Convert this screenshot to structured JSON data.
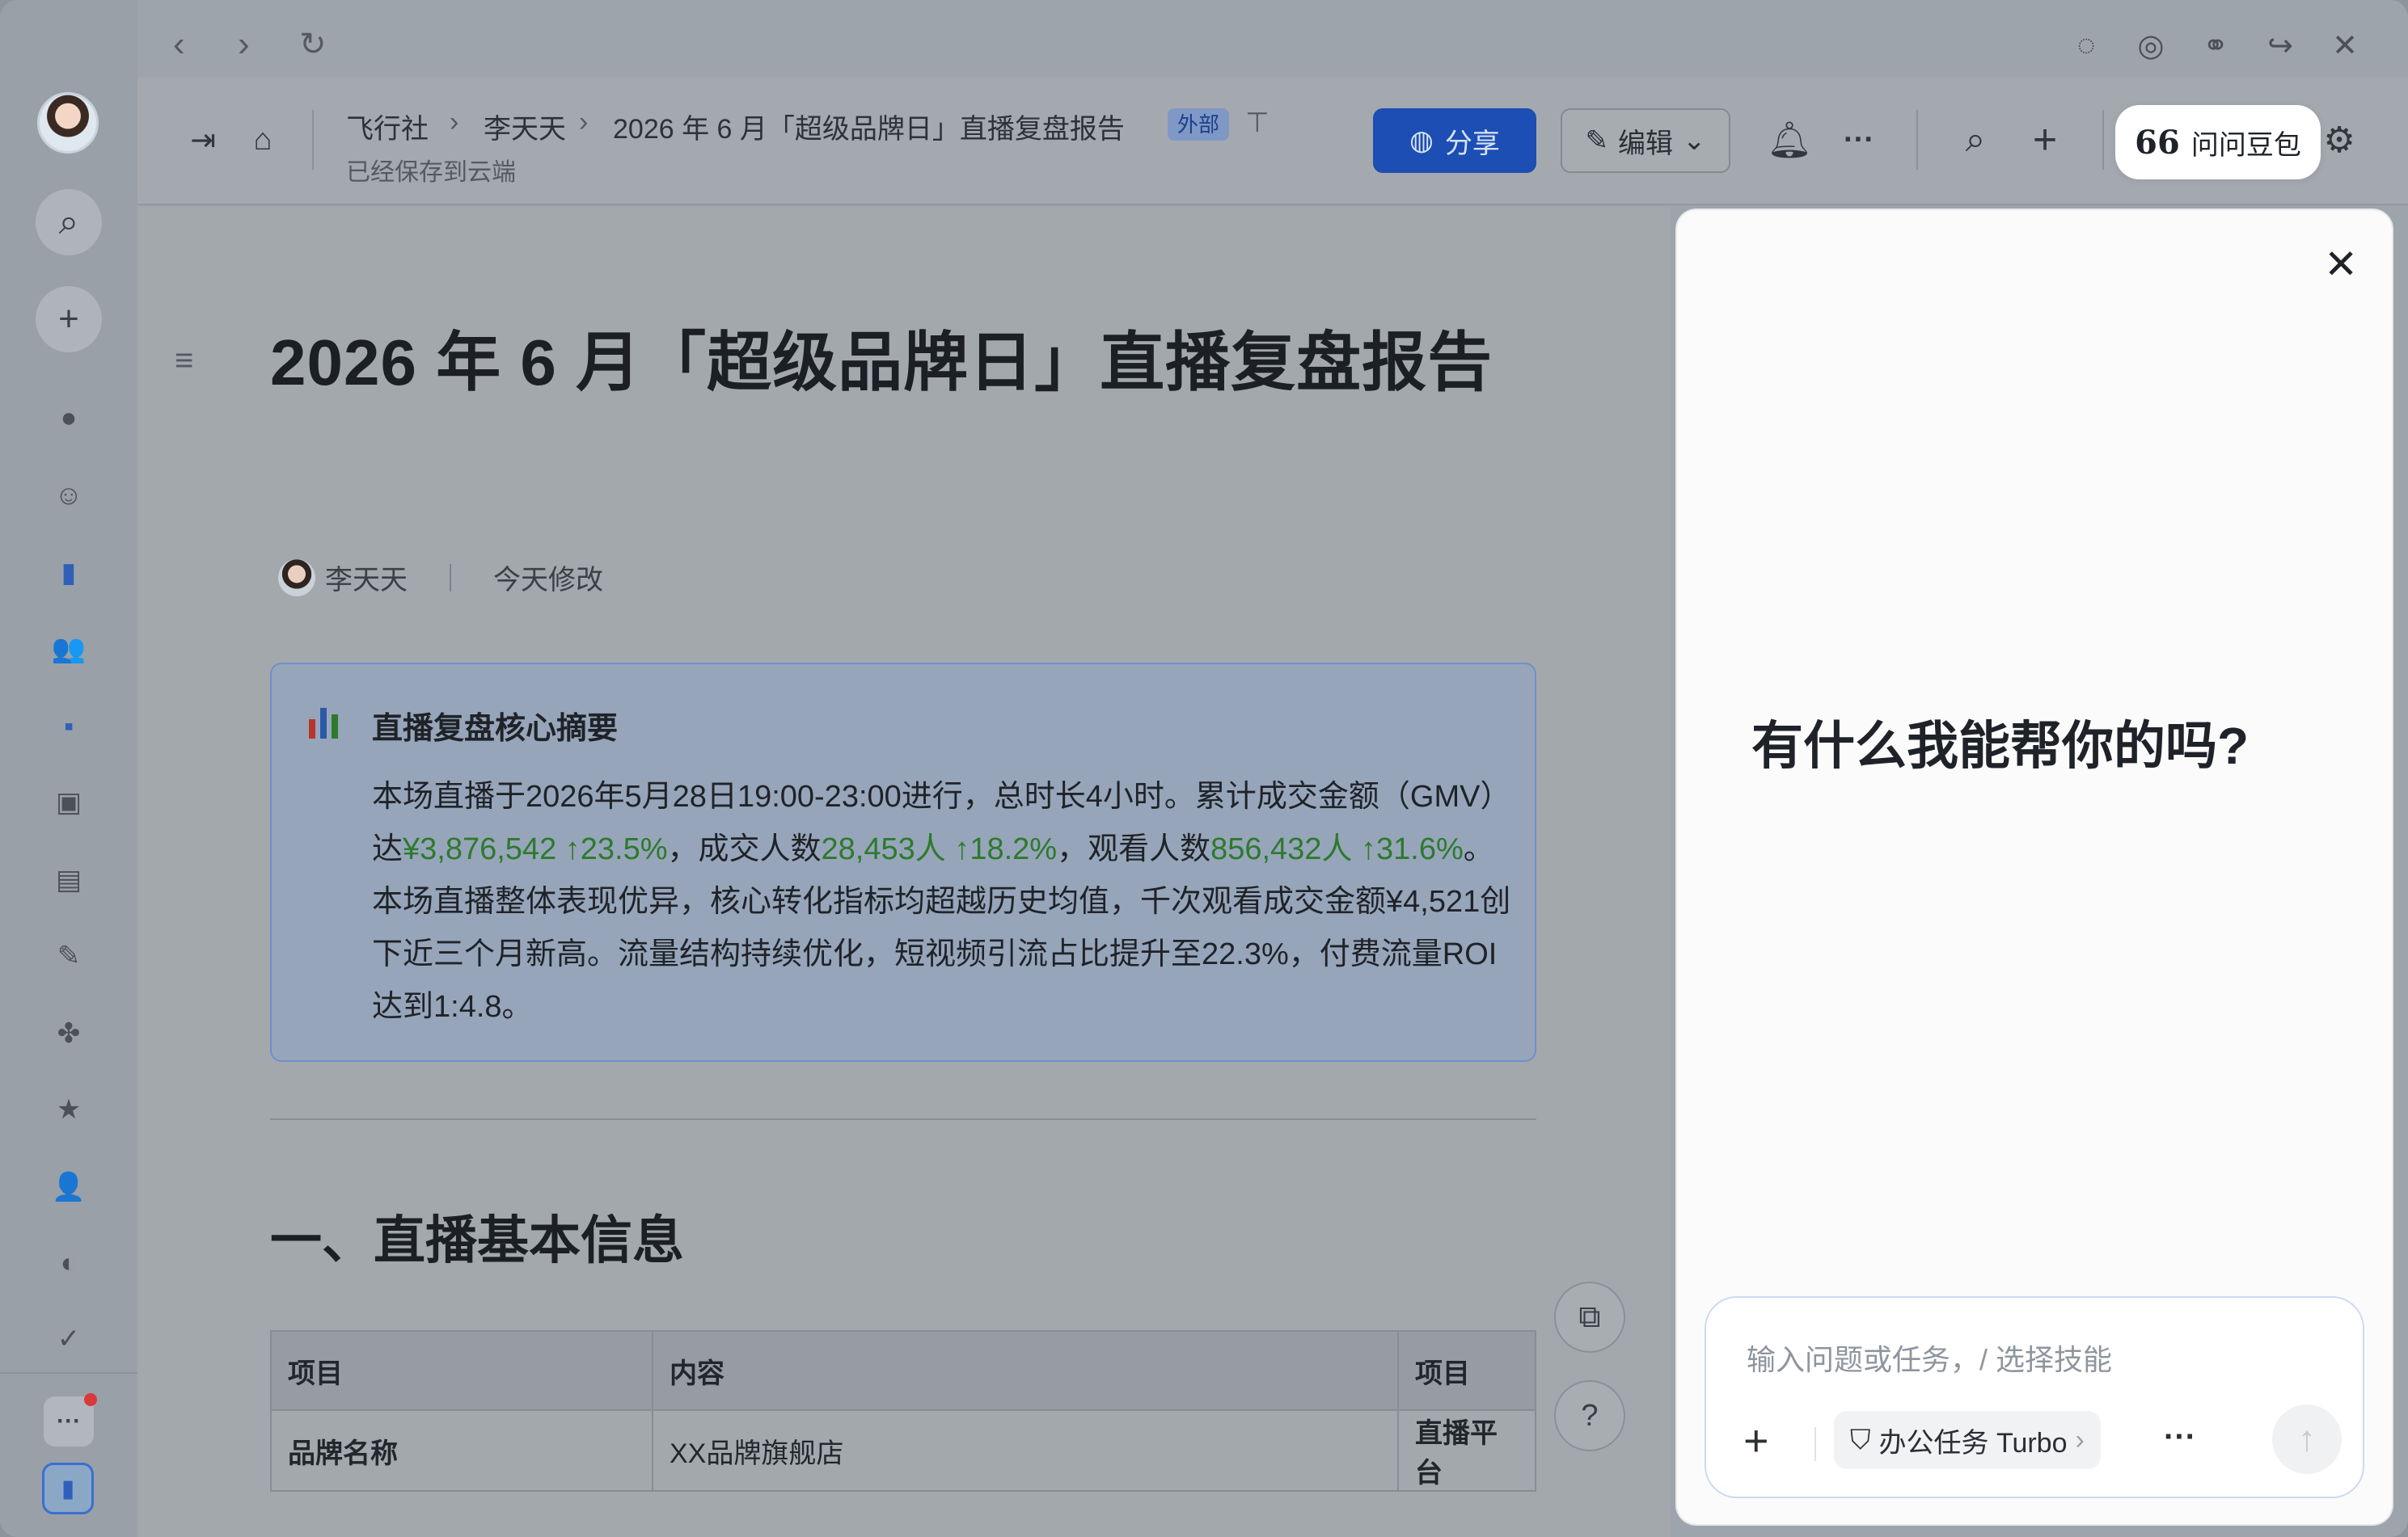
{
  "window": {
    "nav": {
      "back": "‹",
      "forward": "›",
      "reload": "↻"
    },
    "top_right_icons": [
      "comment-icon",
      "compass-icon",
      "link-icon",
      "share-arrow-icon",
      "close-icon"
    ]
  },
  "sidebar": {
    "items": [
      "search-icon",
      "add-icon",
      "chat-icon",
      "avatar",
      "docs-icon",
      "contacts-icon",
      "apps-icon",
      "meeting-icon",
      "calendar-icon",
      "approval-icon",
      "workplace-icon",
      "favorites-icon",
      "user-settings-icon",
      "planet-icon",
      "tasks-icon"
    ],
    "more_label": "···"
  },
  "breadcrumb": {
    "items": [
      "飞行社",
      "李天天",
      "2026 年 6 月「超级品牌日」直播复盘报告"
    ],
    "badge": "外部",
    "saved_status": "已经保存到云端"
  },
  "toolbar": {
    "share_label": "分享",
    "edit_label": "编辑",
    "ask_label": "问问豆包",
    "ask_glyph": "66",
    "more_label": "···"
  },
  "document": {
    "title": "2026 年 6 月「超级品牌日」直播复盘报告",
    "author": "李天天",
    "modified": "今天修改",
    "callout": {
      "heading": "直播复盘核心摘要",
      "parts": [
        {
          "t": "本场直播于2026年5月28日19:00-23:00进行，总时长4小时。累计成交金额（GMV）达",
          "g": false
        },
        {
          "t": "¥3,876,542 ↑23.5%",
          "g": true
        },
        {
          "t": "，成交人数",
          "g": false
        },
        {
          "t": "28,453人 ↑18.2%",
          "g": true
        },
        {
          "t": "，观看人数",
          "g": false
        },
        {
          "t": "856,432人 ↑31.6%",
          "g": true
        },
        {
          "t": "。本场直播整体表现优异，核心转化指标均超越历史均值，千次观看成交金额¥4,521创下近三个月新高。流量结构持续优化，短视频引流占比提升至22.3%，付费流量ROI达到1:4.8。",
          "g": false
        }
      ]
    },
    "section_heading": "一、直播基本信息",
    "table": {
      "headers": [
        "项目",
        "内容",
        "项目"
      ],
      "rows": [
        [
          "品牌名称",
          "XX品牌旗舰店",
          "直播平台"
        ]
      ]
    }
  },
  "assistant": {
    "greeting": "有什么我能帮你的吗?",
    "input_placeholder": "输入问题或任务，/ 选择技能",
    "skill_label": "办公任务 Turbo",
    "skill_chevron": "›",
    "more_label": "···"
  },
  "colors": {
    "accent": "#1c4eb3",
    "positive": "#2d7a2d",
    "badge": "#1e3f8a"
  }
}
